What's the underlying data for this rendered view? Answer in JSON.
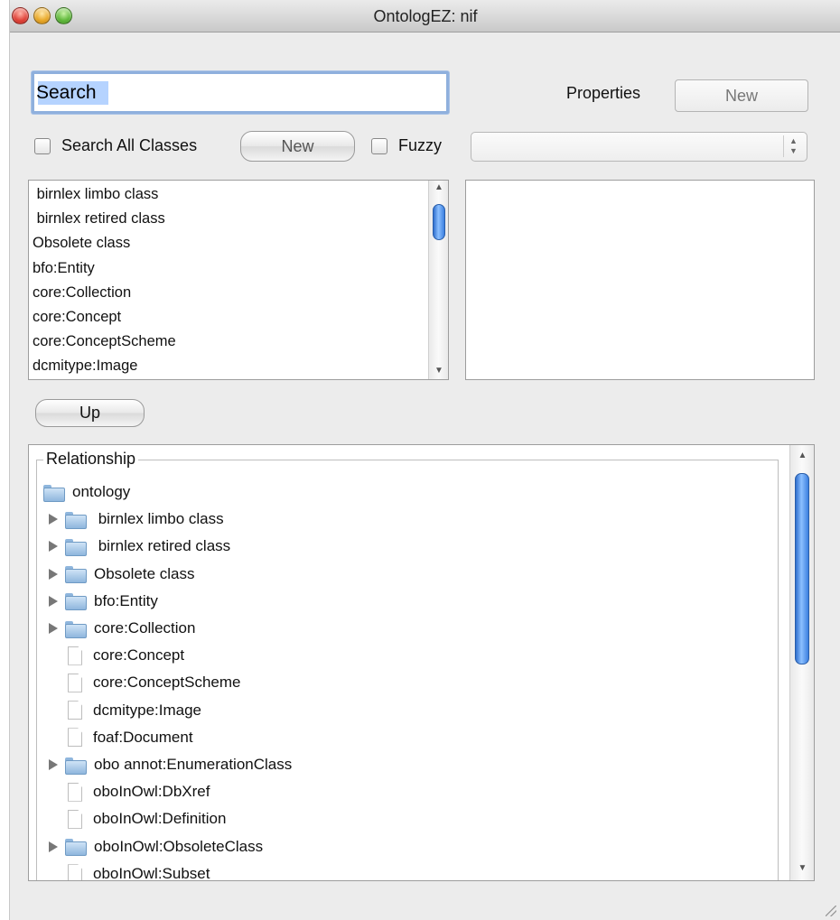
{
  "window": {
    "title": "OntologEZ: nif"
  },
  "search": {
    "value": "Search",
    "placeholder": ""
  },
  "properties": {
    "label": "Properties",
    "new_button": "New",
    "select_value": ""
  },
  "options": {
    "search_all_classes_label": "Search All Classes",
    "search_all_classes_checked": false,
    "new_button": "New",
    "fuzzy_label": "Fuzzy",
    "fuzzy_checked": false
  },
  "class_list": [
    " birnlex limbo class",
    " birnlex retired class",
    "Obsolete class",
    "bfo:Entity",
    "core:Collection",
    "core:Concept",
    "core:ConceptScheme",
    "dcmitype:Image"
  ],
  "up_button": "Up",
  "relationship": {
    "legend": "Relationship",
    "root": "ontology",
    "items": [
      {
        "label": " birnlex limbo class",
        "type": "folder",
        "expandable": true
      },
      {
        "label": " birnlex retired class",
        "type": "folder",
        "expandable": true
      },
      {
        "label": "Obsolete class",
        "type": "folder",
        "expandable": true
      },
      {
        "label": "bfo:Entity",
        "type": "folder",
        "expandable": true
      },
      {
        "label": "core:Collection",
        "type": "folder",
        "expandable": true
      },
      {
        "label": "core:Concept",
        "type": "doc",
        "expandable": false
      },
      {
        "label": "core:ConceptScheme",
        "type": "doc",
        "expandable": false
      },
      {
        "label": "dcmitype:Image",
        "type": "doc",
        "expandable": false
      },
      {
        "label": "foaf:Document",
        "type": "doc",
        "expandable": false
      },
      {
        "label": "obo annot:EnumerationClass",
        "type": "folder",
        "expandable": true
      },
      {
        "label": "oboInOwl:DbXref",
        "type": "doc",
        "expandable": false
      },
      {
        "label": "oboInOwl:Definition",
        "type": "doc",
        "expandable": false
      },
      {
        "label": "oboInOwl:ObsoleteClass",
        "type": "folder",
        "expandable": true
      },
      {
        "label": "oboInOwl:Subset",
        "type": "doc",
        "expandable": false
      }
    ]
  },
  "icons": {
    "close": "close-icon",
    "minimize": "minimize-icon",
    "zoom": "zoom-icon",
    "folder": "folder-icon",
    "document": "document-icon",
    "disclosure": "disclosure-triangle-icon"
  }
}
